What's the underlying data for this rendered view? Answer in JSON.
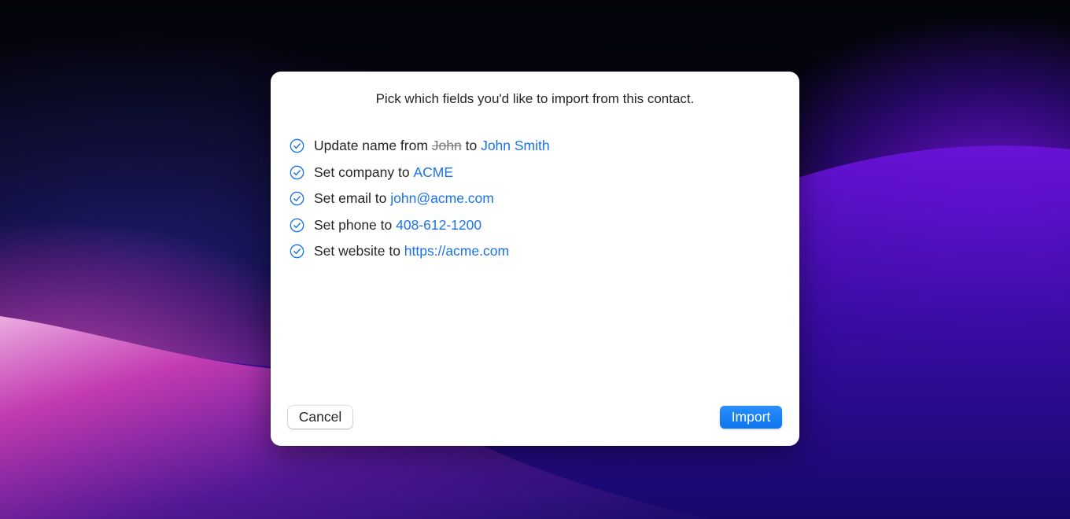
{
  "dialog": {
    "title": "Pick which fields you'd like to import from this contact.",
    "fields": [
      {
        "label": "Update name from ",
        "old_value": "John",
        "connector": " to ",
        "new_value": "John Smith",
        "checked": true
      },
      {
        "label": "Set company to ",
        "new_value": "ACME",
        "checked": true
      },
      {
        "label": "Set email to ",
        "new_value": "john@acme.com",
        "checked": true
      },
      {
        "label": "Set phone to ",
        "new_value": "408-612-1200",
        "checked": true
      },
      {
        "label": "Set website to ",
        "new_value": "https://acme.com",
        "checked": true
      }
    ],
    "cancel_label": "Cancel",
    "import_label": "Import"
  },
  "colors": {
    "accent": "#1a73e8",
    "primary_button": "#0a74f0",
    "text": "#262626",
    "muted_text": "#7a7a7a"
  },
  "icons": {
    "field_check": "checkmark-circle-icon"
  }
}
